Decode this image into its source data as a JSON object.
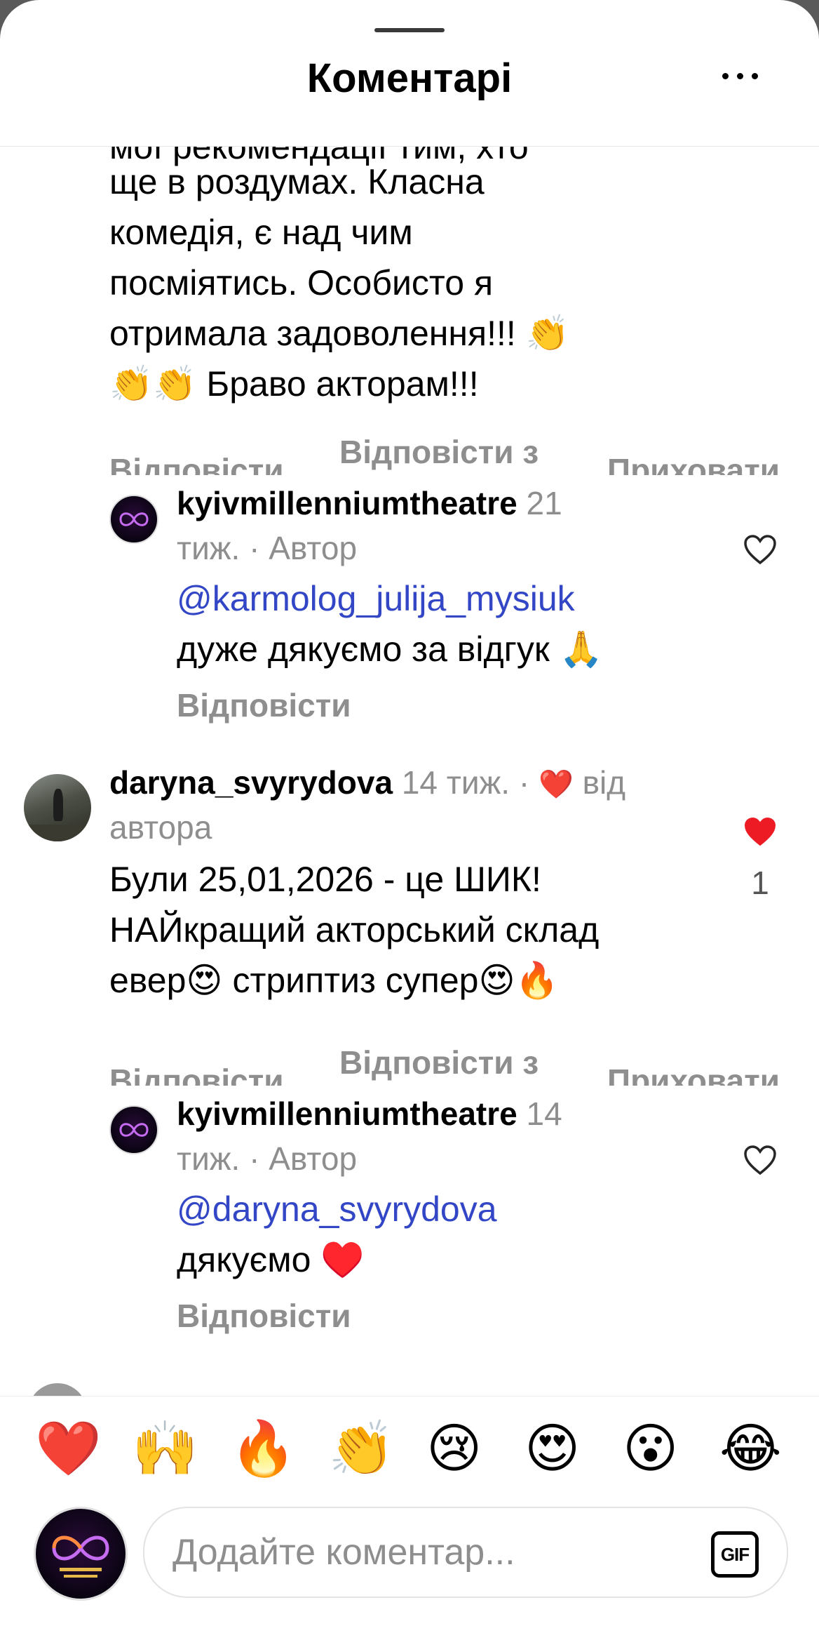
{
  "header": {
    "title": "Коментарі"
  },
  "comments": {
    "first": {
      "cutoff_line": "мої рекомендації тим, хто",
      "text_lines": [
        "ще в роздумах. Класна",
        "комедія, є над чим",
        "посміятись. Особисто я",
        "отримала задоволення!!! 👏",
        "👏👏 Браво акторам!!!"
      ],
      "actions": {
        "reply": "Відповісти",
        "reply_with": "Відповісти з",
        "hide": "Приховати"
      },
      "reply": {
        "username": "kyivmillenniumtheatre",
        "time_prefix": "21",
        "time_suffix": "тиж. · Автор",
        "mention": "@karmolog_julija_mysiuk",
        "text": "дуже дякуємо за відгук 🙏",
        "reply_label": "Відповісти"
      }
    },
    "second": {
      "username": "daryna_svyrydova",
      "time": "14 тиж. ·",
      "liked_heart": "❤️",
      "from": "від",
      "from_line2": "автора",
      "text_lines": [
        "Були 25,01,2026 - це ШИК!",
        "НАЙкращий акторський склад",
        "евер😍  стриптиз супер😍🔥"
      ],
      "like_count": "1",
      "actions": {
        "reply": "Відповісти",
        "reply_with": "Відповісти з",
        "hide": "Приховати"
      },
      "reply": {
        "username": "kyivmillenniumtheatre",
        "time_prefix": "14",
        "time_suffix": "тиж. · Автор",
        "mention": "@daryna_svyrydova",
        "text": "дякуємо ♥️",
        "reply_label": "Відповісти"
      }
    }
  },
  "emoji_bar": [
    "❤️",
    "🙌",
    "🔥",
    "👏",
    "😢",
    "😍",
    "😮",
    "😂"
  ],
  "compose": {
    "placeholder": "Додайте коментар...",
    "gif_label": "GIF"
  },
  "colors": {
    "mention": "#3347c6",
    "muted": "#8e8e8e",
    "heart": "#ed1c24"
  }
}
